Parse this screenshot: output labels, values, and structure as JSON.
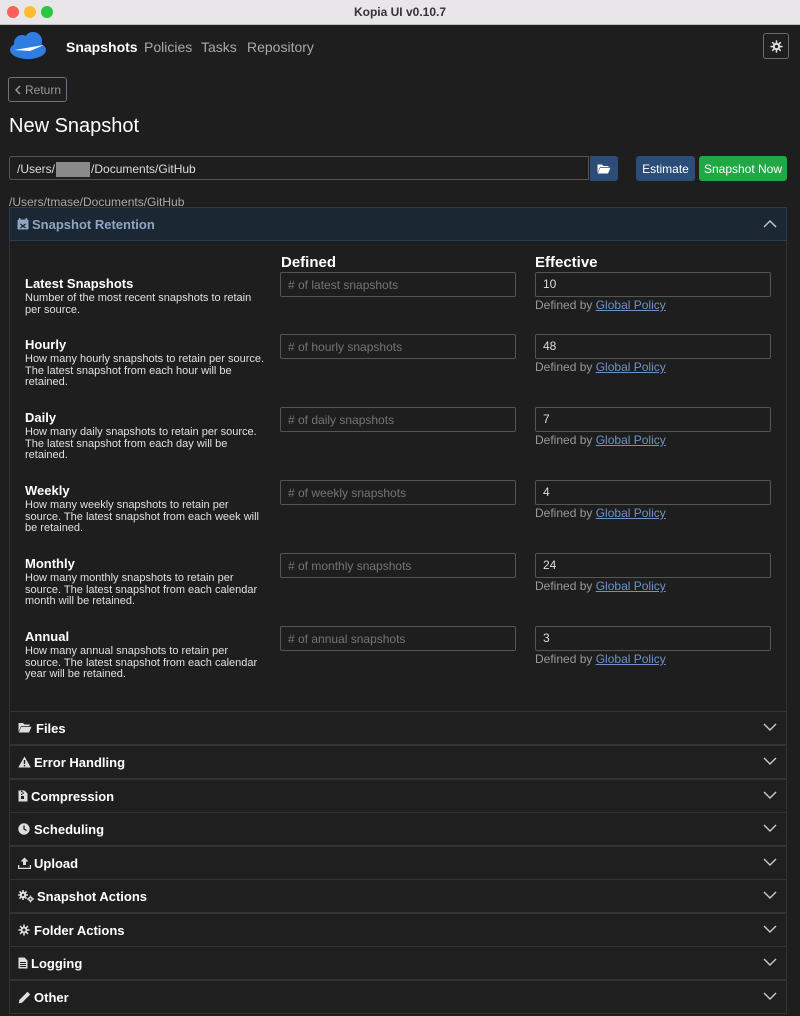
{
  "window": {
    "title": "Kopia UI v0.10.7"
  },
  "nav": {
    "items": [
      "Snapshots",
      "Policies",
      "Tasks",
      "Repository"
    ]
  },
  "return_label": "Return",
  "page_title": "New Snapshot",
  "path": {
    "prefix": "/Users/",
    "suffix": "/Documents/GitHub"
  },
  "resolved_path": "/Users/tmase/Documents/GitHub",
  "buttons": {
    "estimate": "Estimate",
    "snapshot_now": "Snapshot Now"
  },
  "retention": {
    "title": "Snapshot Retention",
    "col_defined": "Defined",
    "col_effective": "Effective",
    "defined_by_prefix": "Defined by",
    "defined_by_link": "Global Policy",
    "rows": [
      {
        "label": "Latest Snapshots",
        "desc": "Number of the most recent snapshots to retain per source.",
        "placeholder": "# of latest snapshots",
        "effective": "10"
      },
      {
        "label": "Hourly",
        "desc": "How many hourly snapshots to retain per source. The latest snapshot from each hour will be retained.",
        "placeholder": "# of hourly snapshots",
        "effective": "48"
      },
      {
        "label": "Daily",
        "desc": "How many daily snapshots to retain per source. The latest snapshot from each day will be retained.",
        "placeholder": "# of daily snapshots",
        "effective": "7"
      },
      {
        "label": "Weekly",
        "desc": "How many weekly snapshots to retain per source. The latest snapshot from each week will be retained.",
        "placeholder": "# of weekly snapshots",
        "effective": "4"
      },
      {
        "label": "Monthly",
        "desc": "How many monthly snapshots to retain per source. The latest snapshot from each calendar month will be retained.",
        "placeholder": "# of monthly snapshots",
        "effective": "24"
      },
      {
        "label": "Annual",
        "desc": "How many annual snapshots to retain per source. The latest snapshot from each calendar year will be retained.",
        "placeholder": "# of annual snapshots",
        "effective": "3"
      }
    ]
  },
  "sections": [
    {
      "label": "Files",
      "icon": "folder-open-icon"
    },
    {
      "label": "Error Handling",
      "icon": "warning-icon"
    },
    {
      "label": "Compression",
      "icon": "file-archive-icon"
    },
    {
      "label": "Scheduling",
      "icon": "clock-icon"
    },
    {
      "label": "Upload",
      "icon": "upload-icon"
    },
    {
      "label": "Snapshot Actions",
      "icon": "cogs-icon"
    },
    {
      "label": "Folder Actions",
      "icon": "cog-icon"
    },
    {
      "label": "Logging",
      "icon": "file-text-icon"
    },
    {
      "label": "Other",
      "icon": "pencil-icon"
    }
  ],
  "colors": {
    "accent_blue": "#2c4d78",
    "success_green": "#1fa844",
    "link": "#6d94c6"
  }
}
